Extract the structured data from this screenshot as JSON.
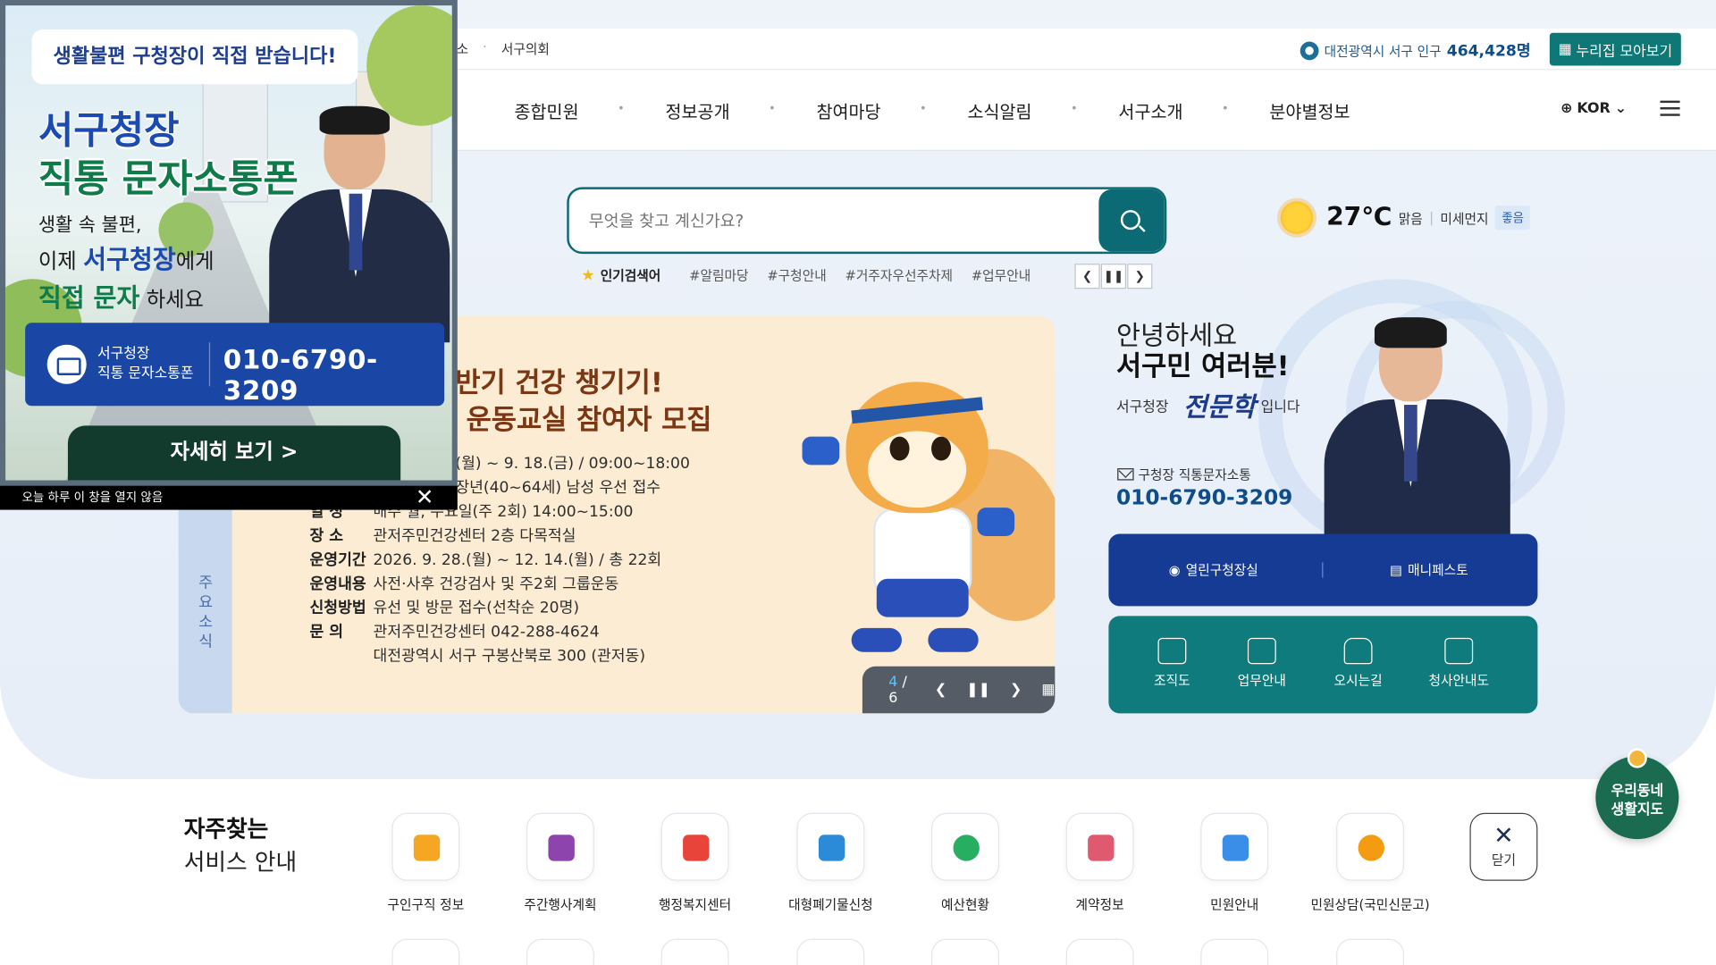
{
  "topbar": {
    "links": [
      "소",
      "서구의회"
    ],
    "population_label": "대전광역시 서구 인구",
    "population_value": "464,428명",
    "nuri_button": "누리집 모아보기"
  },
  "nav": {
    "menus": [
      "종합민원",
      "정보공개",
      "참여마당",
      "소식알림",
      "서구소개",
      "분야별정보"
    ],
    "lang": "KOR"
  },
  "search": {
    "placeholder": "무엇을 찾고 계신가요?",
    "hot_label": "인기검색어",
    "hot_tags": [
      "#알림마당",
      "#구청안내",
      "#거주자우선주차제",
      "#업무안내"
    ]
  },
  "weather": {
    "temp": "27℃",
    "condition": "맑음",
    "dust_label": "미세먼지",
    "dust_value": "좋음"
  },
  "banner": {
    "side_label": "주요소식",
    "title_line1": "반기 건강 챙기기!",
    "title_line2": "운동교실 참여자 모집",
    "rows": [
      {
        "label": "",
        "value": "(월) ~ 9. 18.(금) / 09:00~18:00"
      },
      {
        "label": "",
        "value": "장년(40~64세) 남성 우선 접수"
      },
      {
        "label": "일 정",
        "value": "매주 월, 수요일(주 2회) 14:00~15:00"
      },
      {
        "label": "장 소",
        "value": "관저주민건강센터 2층 다목적실"
      },
      {
        "label": "운영기간",
        "value": "2026. 9. 28.(월) ~ 12. 14.(월) / 총 22회"
      },
      {
        "label": "운영내용",
        "value": "사전·사후 건강검사 및 주2회 그룹운동"
      },
      {
        "label": "신청방법",
        "value": "유선 및 방문 접수(선착순 20명)"
      },
      {
        "label": "문 의",
        "value": "관저주민건강센터 042-288-4624"
      },
      {
        "label": "",
        "value": "대전광역시 서구 구봉산북로 300 (관저동)"
      }
    ],
    "current_page": "4",
    "total_pages": "6"
  },
  "greeting": {
    "line1": "안녕하세요",
    "line2": "서구민 여러분!",
    "line3_prefix": "서구청장",
    "signature": "전문학",
    "line3_suffix": "입니다",
    "mail_label": "구청장 직통문자소통",
    "phone": "010-6790-3209"
  },
  "quick_blue": [
    "열린구청장실",
    "매니페스토"
  ],
  "quick_teal": [
    "조직도",
    "업무안내",
    "오시는길",
    "청사안내도"
  ],
  "frequent": {
    "title_bold": "자주찾는",
    "title_light": "서비스 안내",
    "items": [
      {
        "label": "구인구직 정보",
        "color": "#f5a623"
      },
      {
        "label": "주간행사계획",
        "color": "#8e44ad"
      },
      {
        "label": "행정복지센터",
        "color": "#e8443a"
      },
      {
        "label": "대형폐기물신청",
        "color": "#2b8bd8"
      },
      {
        "label": "예산현황",
        "color": "#27ae60"
      },
      {
        "label": "계약정보",
        "color": "#e05a6f"
      },
      {
        "label": "민원안내",
        "color": "#3a8ee8"
      },
      {
        "label": "민원상담(국민신문고)",
        "color": "#f39c12"
      }
    ],
    "close_label": "닫기"
  },
  "map_badge": {
    "line1": "우리동네",
    "line2": "생활지도"
  },
  "popup": {
    "speech": "생활불편 구청장이 직접 받습니다!",
    "title1": "서구청장",
    "title2": "직통 문자소통폰",
    "body1": "생활 속 불편,",
    "body2_prefix": "이제",
    "body2_strong": "서구청장",
    "body2_suffix": "에게",
    "body3_strong": "직접 문자",
    "body3_suffix": "하세요",
    "phone_label_1": "서구청장",
    "phone_label_2": "직통 문자소통폰",
    "phone": "010-6790-3209",
    "more": "자세히 보기 >",
    "footer": "오늘 하루 이 창을 열지 않음"
  },
  "colors": {
    "primary_teal": "#0b6a73",
    "navy": "#163b94",
    "teal_panel": "#0f7b7c"
  }
}
